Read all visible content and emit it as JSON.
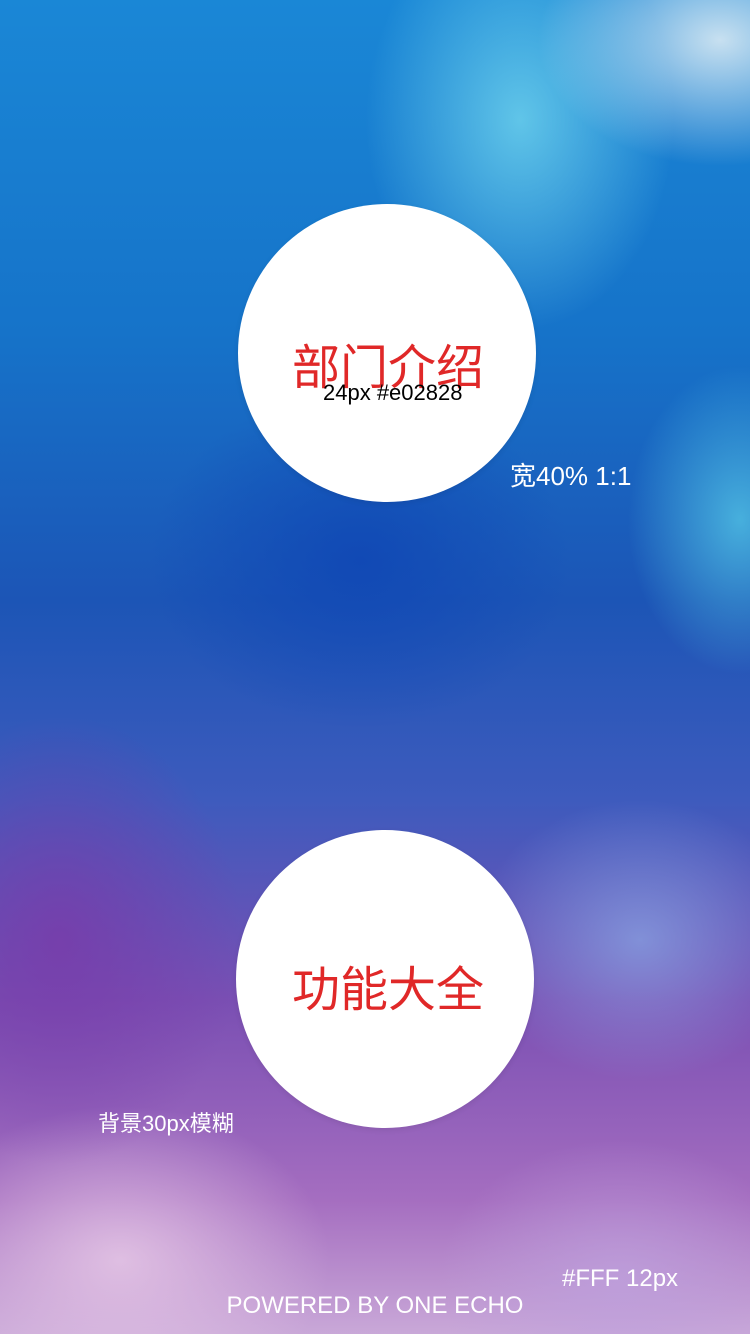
{
  "menu": {
    "department_intro": "部门介绍",
    "all_features": "功能大全"
  },
  "annotations": {
    "font_spec": "24px #e02828",
    "width_spec": "宽40% 1:1",
    "background_spec": "背景30px模糊",
    "footer_font_spec": "#FFF 12px"
  },
  "footer": {
    "text": "POWERED BY ONE ECHO"
  },
  "colors": {
    "label": "#e02828",
    "circle_bg": "#ffffff",
    "footer_text": "#ffffff"
  }
}
